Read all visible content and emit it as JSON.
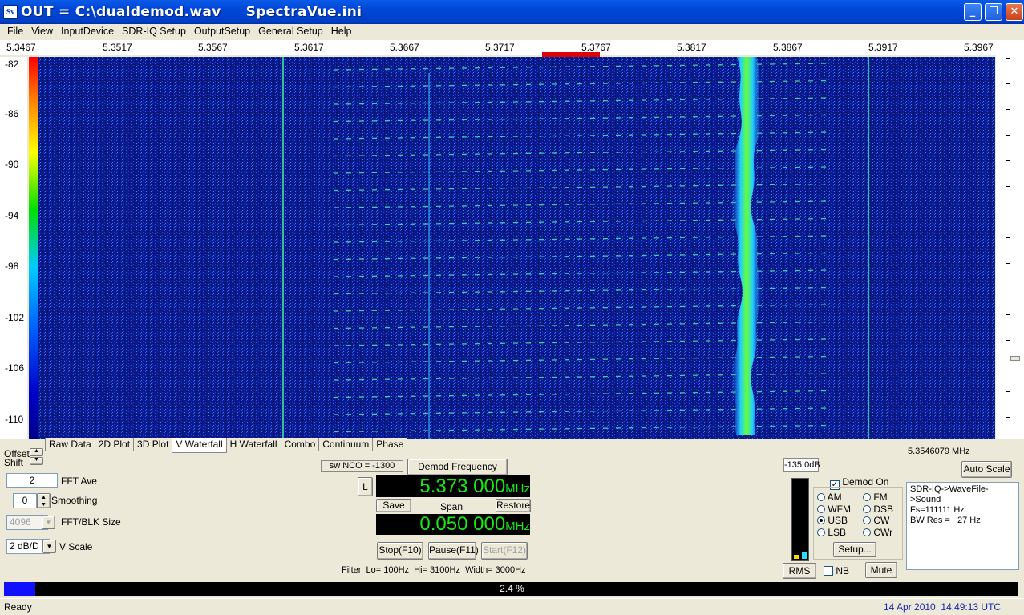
{
  "window": {
    "icon_text": "Sv",
    "title": "OUT = C:\\dualdemod.wav     SpectraVue.ini",
    "min": "_",
    "max": "❐",
    "close": "✕"
  },
  "menu": [
    "File",
    "View",
    "InputDevice",
    "SDR-IQ Setup",
    "OutputSetup",
    "General Setup",
    "Help"
  ],
  "freq_axis": [
    "5.3467",
    "5.3517",
    "5.3567",
    "5.3617",
    "5.3667",
    "5.3717",
    "5.3767",
    "5.3817",
    "5.3867",
    "5.3917",
    "5.3967"
  ],
  "db_axis": [
    "-82",
    "-86",
    "-90",
    "-94",
    "-98",
    "-102",
    "-106",
    "-110"
  ],
  "tabs": [
    "Raw Data",
    "2D Plot",
    "3D Plot",
    "V Waterfall",
    "H Waterfall",
    "Combo",
    "Continuum",
    "Phase"
  ],
  "active_tab": "V Waterfall",
  "offset_label": "Offset",
  "shift_label": "Shift",
  "fft_ave": {
    "value": "2",
    "label": "FFT Ave"
  },
  "smoothing": {
    "value": "0",
    "label": "Smoothing"
  },
  "fft_blk": {
    "value": "4096",
    "label": "FFT/BLK Size"
  },
  "vscale": {
    "value": "2 dB/D",
    "label": "V Scale"
  },
  "sw_nco": "sw NCO = -1300",
  "demod_freq_button": "Demod Frequency",
  "l_button": "L",
  "center_freq": {
    "value": "5.373 000",
    "unit": "MHz"
  },
  "save_button": "Save",
  "span_label": "Span",
  "restore_button": "Restore",
  "span_freq": {
    "value": "0.050 000",
    "unit": "MHz"
  },
  "stop_button": "Stop(F10)",
  "pause_button": "Pause(F11)",
  "start_button": "Start(F12)",
  "filter_text": "Filter  Lo= 100Hz  Hi= 3100Hz  Width= 3000Hz",
  "cursor_freq": "5.3546079 MHz",
  "auto_scale": "Auto Scale",
  "level_readout": "-135.0dB",
  "rms_button": "RMS",
  "demod_on": "Demod On",
  "modes": [
    {
      "label": "AM",
      "on": false
    },
    {
      "label": "FM",
      "on": false
    },
    {
      "label": "WFM",
      "on": false
    },
    {
      "label": "DSB",
      "on": false
    },
    {
      "label": "USB",
      "on": true
    },
    {
      "label": "CW",
      "on": false
    },
    {
      "label": "LSB",
      "on": false
    },
    {
      "label": "CWr",
      "on": false
    }
  ],
  "setup_button": "Setup...",
  "nb_label": "NB",
  "mute_button": "Mute",
  "info": [
    "SDR-IQ->WaveFile->Sound",
    "Fs=111111 Hz",
    "BW Res =   27 Hz"
  ],
  "progress": {
    "text": "2.4 %",
    "fraction": 0.024
  },
  "status": {
    "left": "Ready",
    "right": "14 Apr 2010  14:49:13 UTC"
  },
  "colors": {
    "titlebar": "#0046d8",
    "lcd_text": "#19e619",
    "waterfall_bg": "#0b1a8a",
    "signal": "#39e639",
    "progress": "#1010ff"
  }
}
